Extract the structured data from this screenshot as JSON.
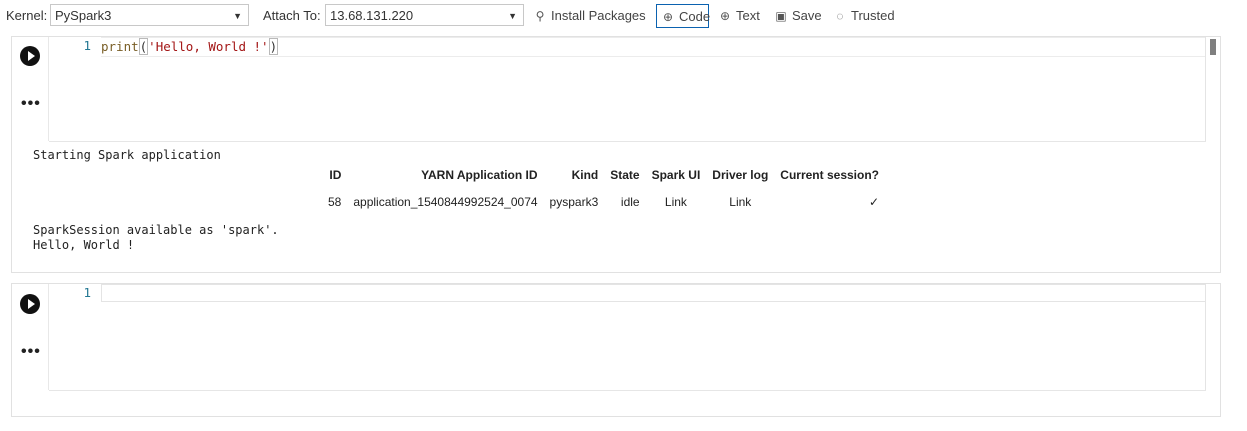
{
  "toolbar": {
    "kernel_label": "Kernel:",
    "kernel_value": "PySpark3",
    "attach_label": "Attach To:",
    "attach_value": "13.68.131.220",
    "install_packages": "Install Packages",
    "code": "Code",
    "text": "Text",
    "save": "Save",
    "trusted": "Trusted",
    "icons": {
      "install_packages": "wrench-icon",
      "code": "plus-circle-icon",
      "text": "plus-circle-icon",
      "save": "save-icon",
      "trusted": "shield-icon"
    }
  },
  "cells": [
    {
      "line_number": "1",
      "code_func": "print",
      "code_open": "(",
      "code_string": "'Hello, World !'",
      "code_close": ")",
      "output": {
        "start_text": "Starting Spark application",
        "table": {
          "headers": [
            "ID",
            "YARN Application ID",
            "Kind",
            "State",
            "Spark UI",
            "Driver log",
            "Current session?"
          ],
          "row": [
            "58",
            "application_1540844992524_0074",
            "pyspark3",
            "idle",
            "Link",
            "Link",
            "✓"
          ]
        },
        "session_text": "SparkSession available as 'spark'.",
        "print_text": "Hello, World !"
      }
    },
    {
      "line_number": "1"
    }
  ],
  "colors": {
    "active_border": "#0b62b0",
    "line_number": "#237893",
    "string": "#a31515"
  }
}
